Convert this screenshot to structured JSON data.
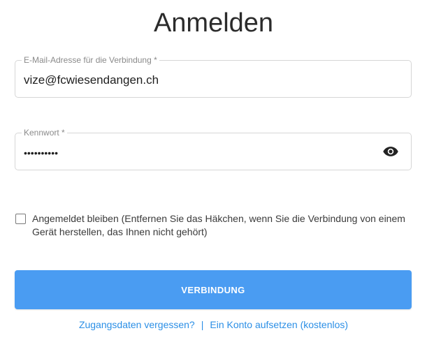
{
  "page": {
    "title": "Anmelden"
  },
  "email": {
    "label": "E-Mail-Adresse für die Verbindung *",
    "value": "vize@fcwiesendangen.ch"
  },
  "password": {
    "label": "Kennwort *",
    "masked_value": "••••••••••",
    "toggle_icon": "eye-icon"
  },
  "remember": {
    "checked": false,
    "label": "Angemeldet bleiben (Entfernen Sie das Häkchen, wenn Sie die Verbindung von einem Gerät herstellen, das Ihnen nicht gehört)"
  },
  "submit": {
    "label": "VERBINDUNG"
  },
  "links": {
    "forgot": "Zugangsdaten vergessen?",
    "separator": "|",
    "register": "Ein Konto aufsetzen (kostenlos)"
  },
  "colors": {
    "accent": "#4a9cf2",
    "link": "#2b8fe6",
    "border": "#d6d6d6"
  }
}
